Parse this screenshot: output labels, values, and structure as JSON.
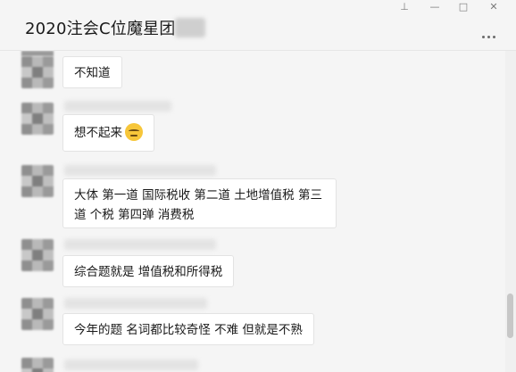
{
  "window": {
    "title": "2020注会C位魔星团",
    "controls": {
      "pin": "⊥",
      "minimize": "—",
      "maximize": "□",
      "close": "✕"
    }
  },
  "messages": [
    {
      "text": "不知道"
    },
    {
      "text": "想不起来",
      "emoji": "sleepy-face-icon"
    },
    {
      "line1": "大体 第一道 国际税收 第二道 土地增值税 第三",
      "line2": "道 个税 第四弹 消费税"
    },
    {
      "text": "综合题就是 增值税和所得税"
    },
    {
      "text": "今年的题 名词都比较奇怪 不难 但就是不熟"
    }
  ]
}
